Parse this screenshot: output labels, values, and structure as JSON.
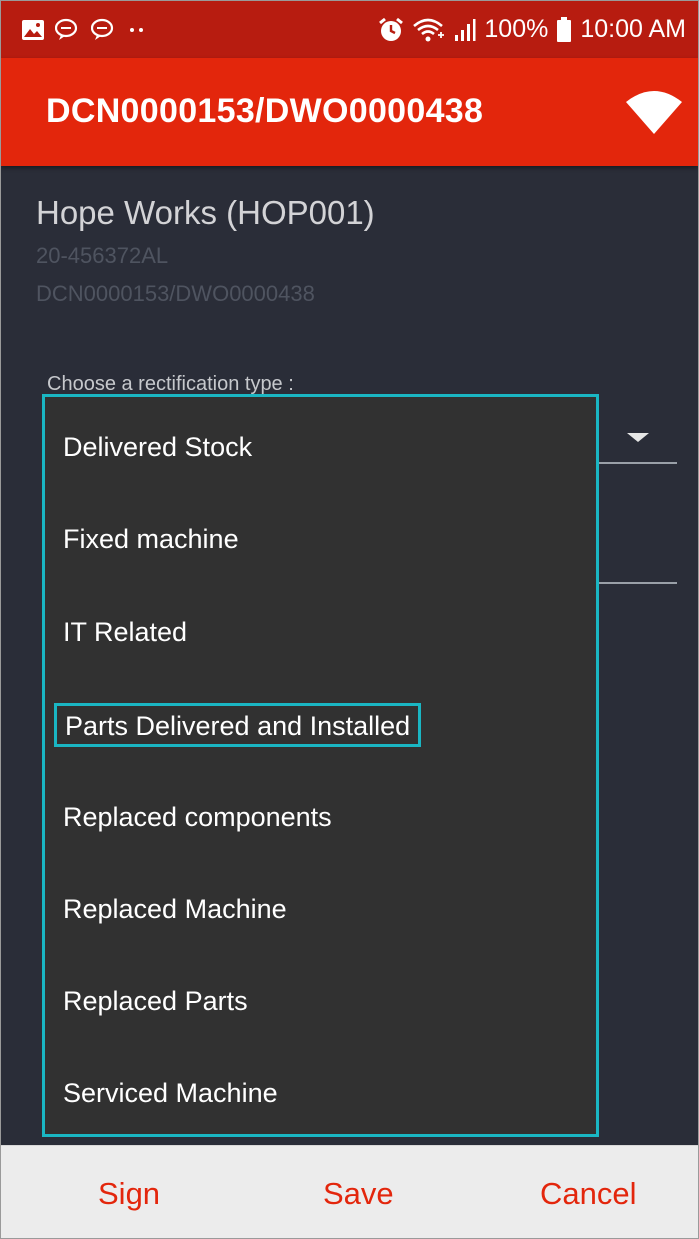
{
  "status_bar": {
    "battery": "100%",
    "time": "10:00 AM"
  },
  "app_bar": {
    "title": "DCN0000153/DWO0000438"
  },
  "header": {
    "customer": "Hope Works (HOP001)",
    "line1": "20-456372AL",
    "line2": "DCN0000153/DWO0000438"
  },
  "form": {
    "rectification_label": "Choose a rectification type :"
  },
  "dropdown": {
    "items": [
      {
        "label": "Delivered Stock"
      },
      {
        "label": "Fixed machine"
      },
      {
        "label": "IT Related"
      },
      {
        "label": "Parts Delivered and Installed"
      },
      {
        "label": "Replaced components"
      },
      {
        "label": "Replaced Machine"
      },
      {
        "label": "Replaced Parts"
      },
      {
        "label": "Serviced Machine"
      }
    ],
    "highlighted_index": 3
  },
  "bottom_bar": {
    "sign": "Sign",
    "save": "Save",
    "cancel": "Cancel"
  },
  "colors": {
    "status_bar": "#b71c10",
    "app_bar": "#e3260c",
    "accent_highlight": "#1ab6c3",
    "action_text": "#e3260c"
  },
  "icons": {
    "status_left": [
      "gallery-icon",
      "chat-icon",
      "chat-icon",
      "more-dots-icon"
    ],
    "status_right": [
      "alarm-icon",
      "wifi-status-icon",
      "signal-icon",
      "battery-icon"
    ],
    "app_bar": "wifi-icon"
  }
}
